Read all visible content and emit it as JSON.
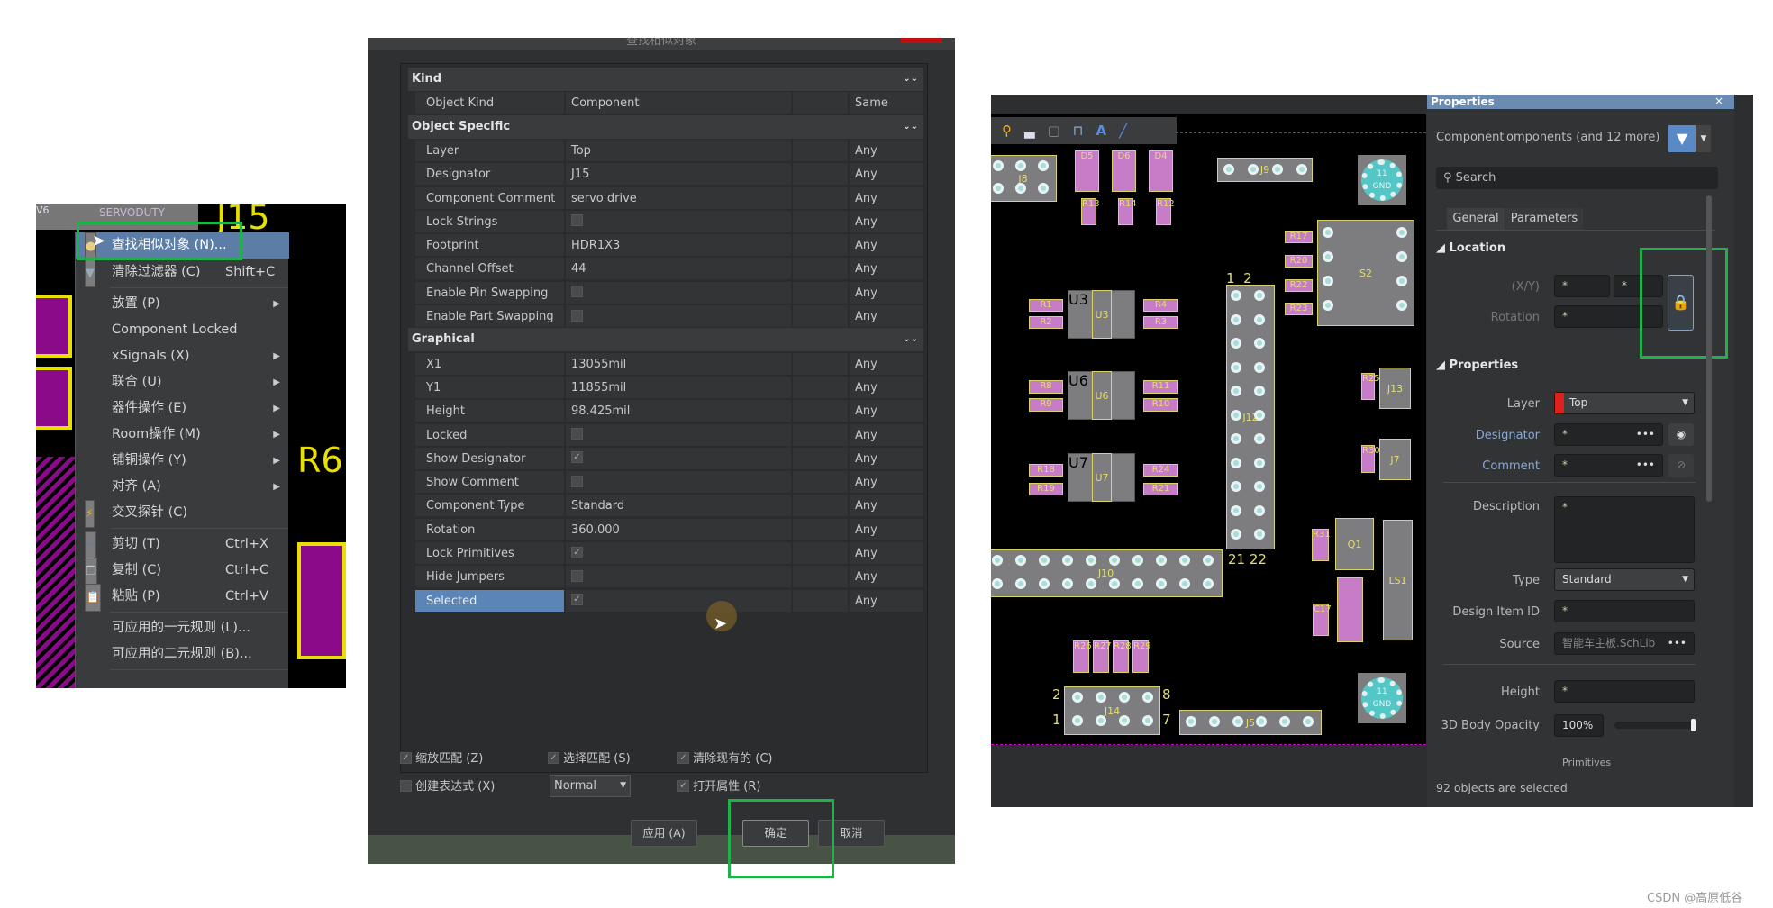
{
  "context_menu": {
    "items": [
      {
        "label": "查找相似对象 (N)...",
        "shortcut": "",
        "icon": "find-similar-icon",
        "submenu": false,
        "highlighted": true
      },
      {
        "label": "清除过滤器 (C)",
        "shortcut": "Shift+C",
        "icon": "clear-filter-icon",
        "submenu": false
      },
      {
        "label": "放置 (P)",
        "shortcut": "",
        "submenu": true
      },
      {
        "label": "Component Locked",
        "shortcut": "",
        "submenu": false
      },
      {
        "label": "xSignals (X)",
        "shortcut": "",
        "submenu": true
      },
      {
        "label": "联合 (U)",
        "shortcut": "",
        "submenu": true
      },
      {
        "label": "器件操作 (E)",
        "shortcut": "",
        "submenu": true
      },
      {
        "label": "Room操作 (M)",
        "shortcut": "",
        "submenu": true
      },
      {
        "label": "铺铜操作 (Y)",
        "shortcut": "",
        "submenu": true
      },
      {
        "label": "对齐 (A)",
        "shortcut": "",
        "submenu": true
      },
      {
        "label": "交叉探针 (C)",
        "shortcut": "",
        "icon": "cross-probe-icon",
        "submenu": false
      },
      {
        "label": "剪切 (T)",
        "shortcut": "Ctrl+X",
        "icon": "cut-icon"
      },
      {
        "label": "复制 (C)",
        "shortcut": "Ctrl+C",
        "icon": "copy-icon"
      },
      {
        "label": "粘贴 (P)",
        "shortcut": "Ctrl+V",
        "icon": "paste-icon"
      },
      {
        "label": "可应用的一元规则 (L)...",
        "shortcut": ""
      },
      {
        "label": "可应用的二元规则 (B)...",
        "shortcut": ""
      }
    ],
    "background_labels": {
      "top": "SERVODUTY",
      "j15": "J15",
      "r6": "R6",
      "v6": "V6"
    }
  },
  "dialog": {
    "title": "查找相似对象",
    "sections": [
      {
        "title": "Kind",
        "rows": [
          {
            "label": "Object Kind",
            "value": "Component",
            "match": "Same"
          }
        ]
      },
      {
        "title": "Object Specific",
        "rows": [
          {
            "label": "Layer",
            "value": "Top",
            "match": "Any"
          },
          {
            "label": "Designator",
            "value": "J15",
            "match": "Any"
          },
          {
            "label": "Component Comment",
            "value": "servo drive",
            "match": "Any"
          },
          {
            "label": "Lock Strings",
            "checkbox": false,
            "match": "Any"
          },
          {
            "label": "Footprint",
            "value": "HDR1X3",
            "match": "Any"
          },
          {
            "label": "Channel Offset",
            "value": "44",
            "match": "Any"
          },
          {
            "label": "Enable Pin Swapping",
            "checkbox": false,
            "match": "Any"
          },
          {
            "label": "Enable Part Swapping",
            "checkbox": false,
            "match": "Any"
          }
        ]
      },
      {
        "title": "Graphical",
        "rows": [
          {
            "label": "X1",
            "value": "13055mil",
            "match": "Any"
          },
          {
            "label": "Y1",
            "value": "11855mil",
            "match": "Any"
          },
          {
            "label": "Height",
            "value": "98.425mil",
            "match": "Any"
          },
          {
            "label": "Locked",
            "checkbox": false,
            "match": "Any"
          },
          {
            "label": "Show Designator",
            "checkbox": true,
            "match": "Any"
          },
          {
            "label": "Show Comment",
            "checkbox": false,
            "match": "Any"
          },
          {
            "label": "Component Type",
            "value": "Standard",
            "match": "Any"
          },
          {
            "label": "Rotation",
            "value": "360.000",
            "match": "Any"
          },
          {
            "label": "Lock Primitives",
            "checkbox": true,
            "match": "Any"
          },
          {
            "label": "Hide Jumpers",
            "checkbox": false,
            "match": "Any"
          },
          {
            "label": "Selected",
            "checkbox": true,
            "match": "Any",
            "selected": true
          }
        ]
      }
    ],
    "options": {
      "zoom_matching": {
        "label": "缩放匹配 (Z)",
        "checked": true
      },
      "select_matching": {
        "label": "选择匹配 (S)",
        "checked": true
      },
      "clear_existing": {
        "label": "清除现有的 (C)",
        "checked": true
      },
      "create_expression": {
        "label": "创建表达式 (X)",
        "checked": false
      },
      "mask_mode": "Normal",
      "open_properties": {
        "label": "打开属性 (R)",
        "checked": true
      }
    },
    "buttons": {
      "apply": "应用 (A)",
      "ok": "确定",
      "cancel": "取消"
    }
  },
  "pcb": {
    "designators": [
      "J8",
      "D5",
      "D6",
      "D4",
      "R13",
      "R14",
      "R12",
      "J9",
      "S2",
      "R17",
      "R20",
      "R22",
      "R23",
      "U3",
      "U6",
      "U7",
      "R1",
      "R2",
      "R4",
      "R3",
      "R8",
      "R9",
      "R11",
      "R10",
      "R18",
      "R19",
      "R24",
      "R21",
      "J12",
      "J10",
      "J14",
      "J5",
      "R26",
      "R27",
      "R28",
      "R29",
      "R25",
      "J13",
      "R30",
      "J7",
      "R31",
      "Q1",
      "LS1",
      "C17"
    ],
    "gnd_label": "11\nGND",
    "pin_labels": {
      "j12_top": "1  2",
      "j12_bottom": "21 22",
      "j14_l1": "2",
      "j14_l2": "1",
      "j14_r1": "8",
      "j14_r2": "7"
    },
    "toolbar_icons": [
      "probe-icon",
      "fill-icon",
      "keepout-icon",
      "component-icon",
      "text-icon",
      "line-icon"
    ],
    "colors": {
      "board": "#000000",
      "pad": "#c77cc7",
      "silk": "#d9d36a",
      "edge": "#cc00cc"
    }
  },
  "properties": {
    "title": "Properties",
    "filter_label": "Component",
    "filter_value": "omponents (and 12 more)",
    "search_placeholder": "Search",
    "tabs": [
      "General",
      "Parameters"
    ],
    "location": {
      "title": "Location",
      "xy_label": "(X/Y)",
      "x": "*",
      "y": "*",
      "rotation_label": "Rotation",
      "rotation": "*",
      "locked": true
    },
    "props": {
      "title": "Properties",
      "layer_label": "Layer",
      "layer": "Top",
      "layer_color": "#e0201a",
      "designator_label": "Designator",
      "designator": "*",
      "comment_label": "Comment",
      "comment": "*",
      "description_label": "Description",
      "description": "*",
      "type_label": "Type",
      "type": "Standard",
      "design_item_label": "Design Item ID",
      "design_item": "*",
      "source_label": "Source",
      "source": "智能车主板.SchLib",
      "height_label": "Height",
      "height": "*",
      "opacity_label": "3D Body Opacity",
      "opacity": "100%",
      "opacity_value": 1.0,
      "primitives_label": "Primitives"
    },
    "status": "92 objects are selected"
  },
  "watermark": "CSDN @高原低谷"
}
